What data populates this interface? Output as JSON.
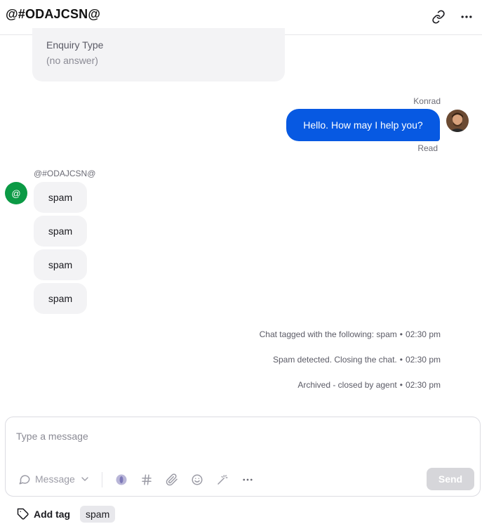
{
  "header": {
    "title": "@#ODAJCSN@",
    "link_icon": "link-icon",
    "more_icon": "more-horizontal-icon"
  },
  "form_card": {
    "question": "Enquiry Type",
    "answer": "(no answer)"
  },
  "agent_message": {
    "author": "Konrad",
    "text": "Hello. How may I help you?",
    "status": "Read",
    "bubble_color": "#0759e2"
  },
  "visitor": {
    "name": "@#ODAJCSN@",
    "avatar_initial": "@",
    "avatar_color": "#0b9a45",
    "messages": [
      "spam",
      "spam",
      "spam",
      "spam"
    ]
  },
  "system_events": [
    {
      "text": "Chat tagged with the following: spam",
      "time": "02:30 pm"
    },
    {
      "text": "Spam detected. Closing the chat.",
      "time": "02:30 pm"
    },
    {
      "text": "Archived - closed by agent",
      "time": "02:30 pm"
    }
  ],
  "composer": {
    "placeholder": "Type a message",
    "mode_label": "Message",
    "send_label": "Send",
    "tools": [
      "ai-assist-icon",
      "hashtag-icon",
      "paperclip-icon",
      "emoji-icon",
      "magic-wand-icon",
      "more-horizontal-icon"
    ]
  },
  "tags": {
    "add_label": "Add tag",
    "items": [
      "spam"
    ]
  },
  "event_separator": "•"
}
